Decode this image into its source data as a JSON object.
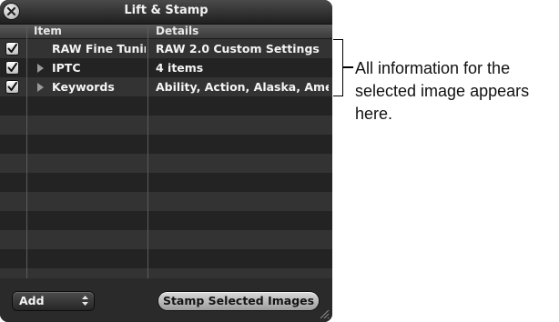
{
  "window": {
    "title": "Lift & Stamp"
  },
  "table": {
    "columns": [
      "Item",
      "Details"
    ],
    "rows": [
      {
        "checked": true,
        "expandable": false,
        "item": "RAW Fine Tunin",
        "details": "RAW 2.0 Custom Settings"
      },
      {
        "checked": true,
        "expandable": true,
        "item": "IPTC",
        "details": "4 items"
      },
      {
        "checked": true,
        "expandable": true,
        "item": "Keywords",
        "details": "Ability, Action, Alaska, Ameri"
      }
    ]
  },
  "footer": {
    "add_label": "Add",
    "stamp_label": "Stamp Selected Images"
  },
  "callout": {
    "text": "All information for the selected image appears here."
  },
  "icons": {
    "close": "close-icon",
    "checkbox": "checkmark-icon",
    "disclosure": "disclosure-triangle-icon",
    "popup_arrows": "updown-arrows-icon",
    "resize": "resize-grip-icon"
  }
}
